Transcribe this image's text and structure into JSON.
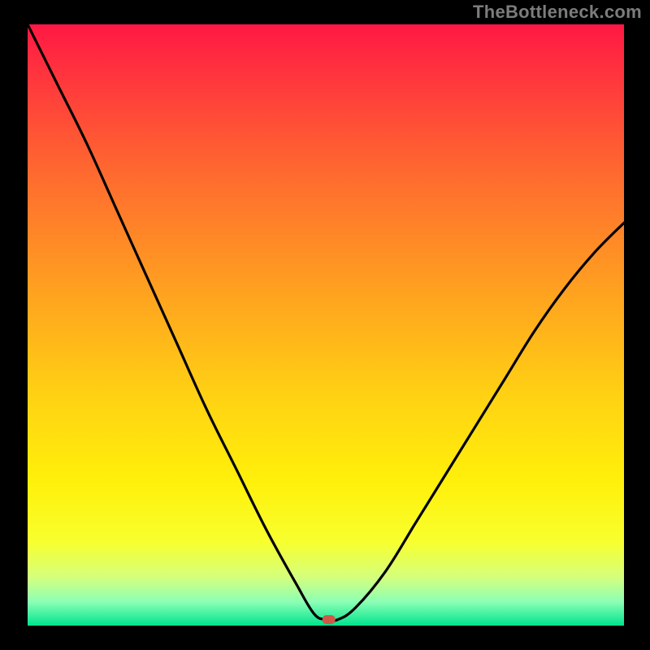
{
  "watermark": "TheBottleneck.com",
  "colors": {
    "frame": "#000000",
    "watermark": "#7c7c7c",
    "curve": "#000000",
    "marker": "#cf5847",
    "gradient_stops": [
      {
        "offset": 0.0,
        "color": "#ff1844"
      },
      {
        "offset": 0.1,
        "color": "#ff3a3c"
      },
      {
        "offset": 0.25,
        "color": "#ff6a2f"
      },
      {
        "offset": 0.45,
        "color": "#ffa31f"
      },
      {
        "offset": 0.62,
        "color": "#ffd213"
      },
      {
        "offset": 0.76,
        "color": "#fff00a"
      },
      {
        "offset": 0.86,
        "color": "#f8ff2e"
      },
      {
        "offset": 0.92,
        "color": "#d4ff7d"
      },
      {
        "offset": 0.96,
        "color": "#8dffb5"
      },
      {
        "offset": 1.0,
        "color": "#00e48e"
      }
    ]
  },
  "chart_data": {
    "type": "line",
    "title": "",
    "xlabel": "",
    "ylabel": "",
    "xlim": [
      0,
      100
    ],
    "ylim": [
      0,
      100
    ],
    "legend": false,
    "grid": false,
    "marker": {
      "x": 50.5,
      "y": 1.0
    },
    "series": [
      {
        "name": "curve",
        "x": [
          0,
          5,
          10,
          15,
          20,
          25,
          30,
          35,
          40,
          45,
          48,
          50,
          52,
          55,
          60,
          65,
          70,
          75,
          80,
          85,
          90,
          95,
          100
        ],
        "y": [
          100,
          90,
          80,
          69,
          58,
          47,
          36,
          26,
          16,
          7,
          2,
          1,
          1,
          3,
          9,
          17,
          25,
          33,
          41,
          49,
          56,
          62,
          67
        ]
      }
    ]
  }
}
